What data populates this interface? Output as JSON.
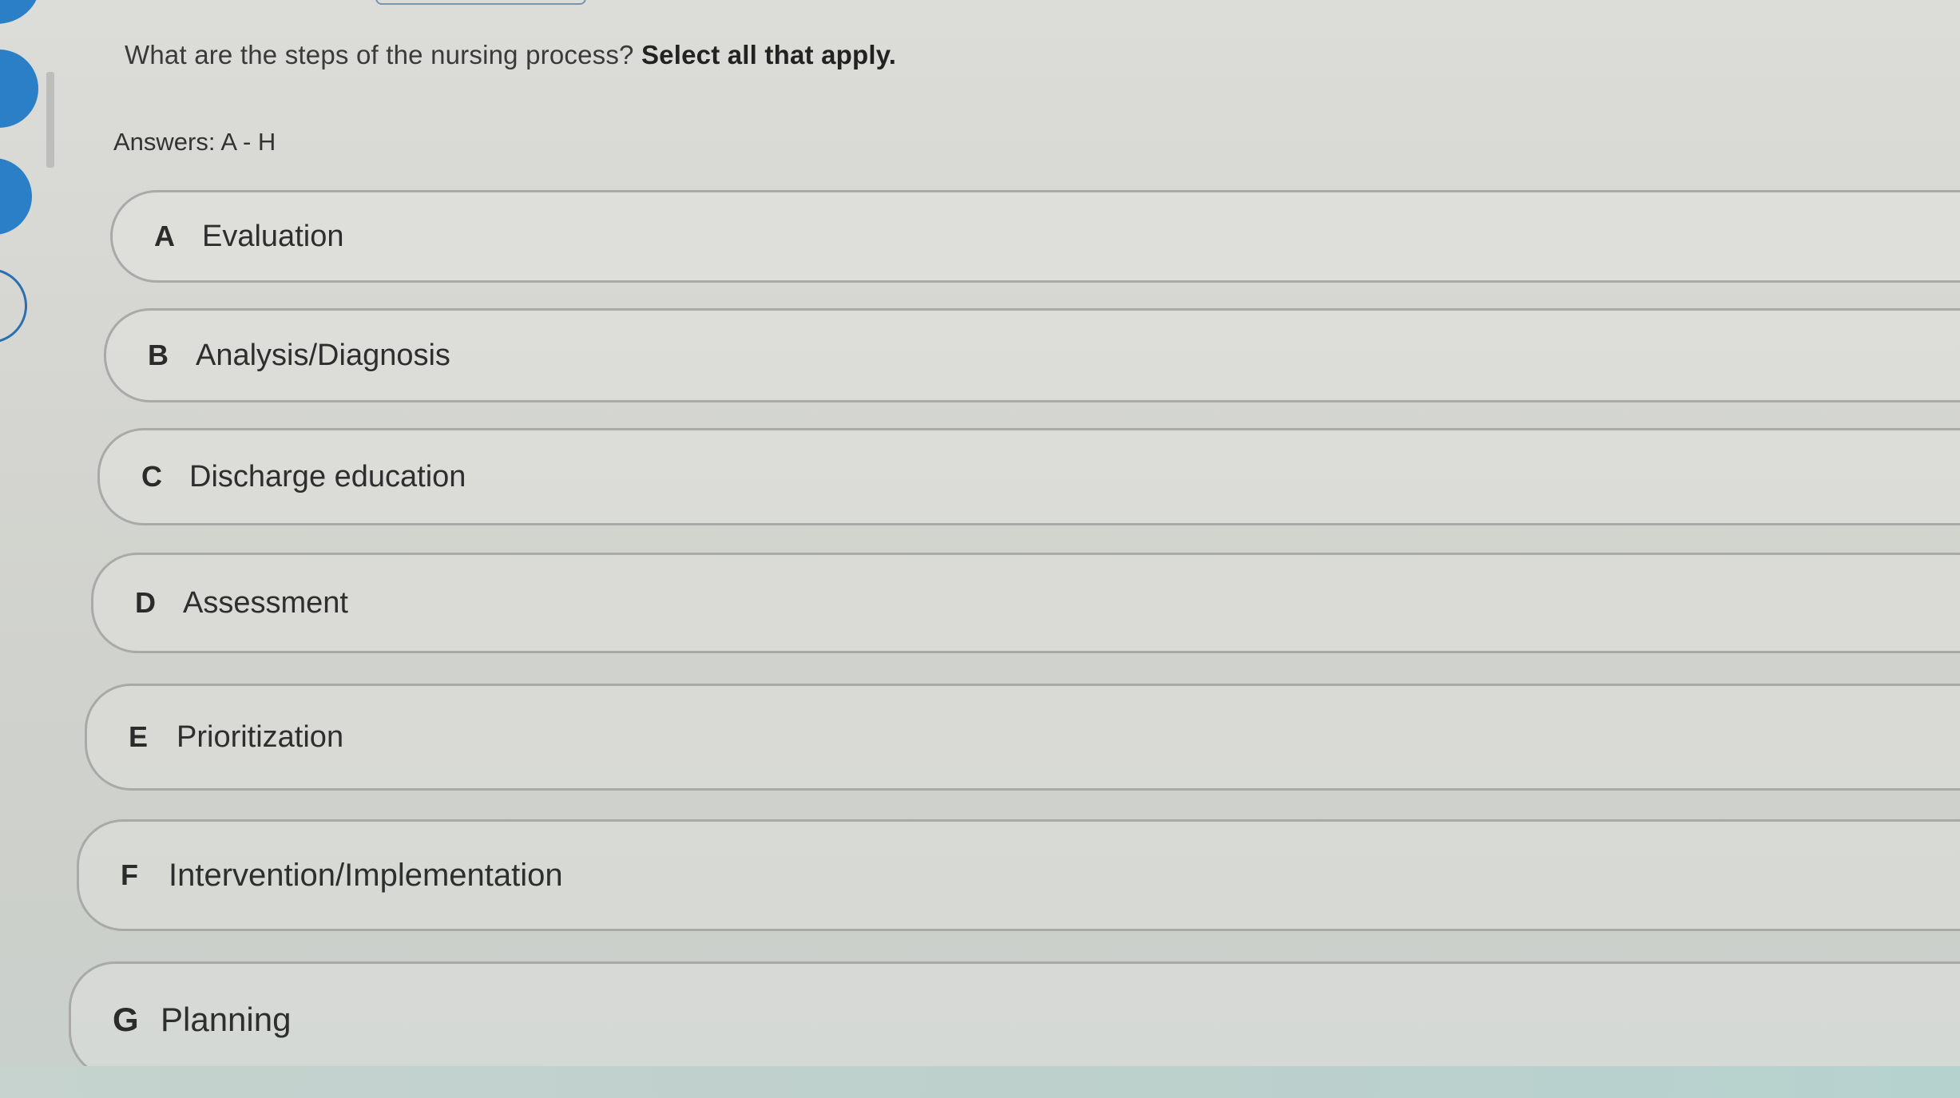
{
  "question": {
    "prefix": "What are the steps of the nursing process?",
    "emphasis": "Select all that apply."
  },
  "answers_hint": "Answers: A - H",
  "options": [
    {
      "letter": "A",
      "label": "Evaluation"
    },
    {
      "letter": "B",
      "label": "Analysis/Diagnosis"
    },
    {
      "letter": "C",
      "label": "Discharge education"
    },
    {
      "letter": "D",
      "label": "Assessment"
    },
    {
      "letter": "E",
      "label": "Prioritization"
    },
    {
      "letter": "F",
      "label": "Intervention/Implementation"
    },
    {
      "letter": "G",
      "label": "Planning"
    }
  ],
  "colors": {
    "accent": "#2a7fc6",
    "option_border": "#a9aaa7",
    "background": "#d6d7d2"
  },
  "icons": {
    "nav_dot": "filled-circle-icon",
    "nav_ring": "circle-outline-icon"
  }
}
